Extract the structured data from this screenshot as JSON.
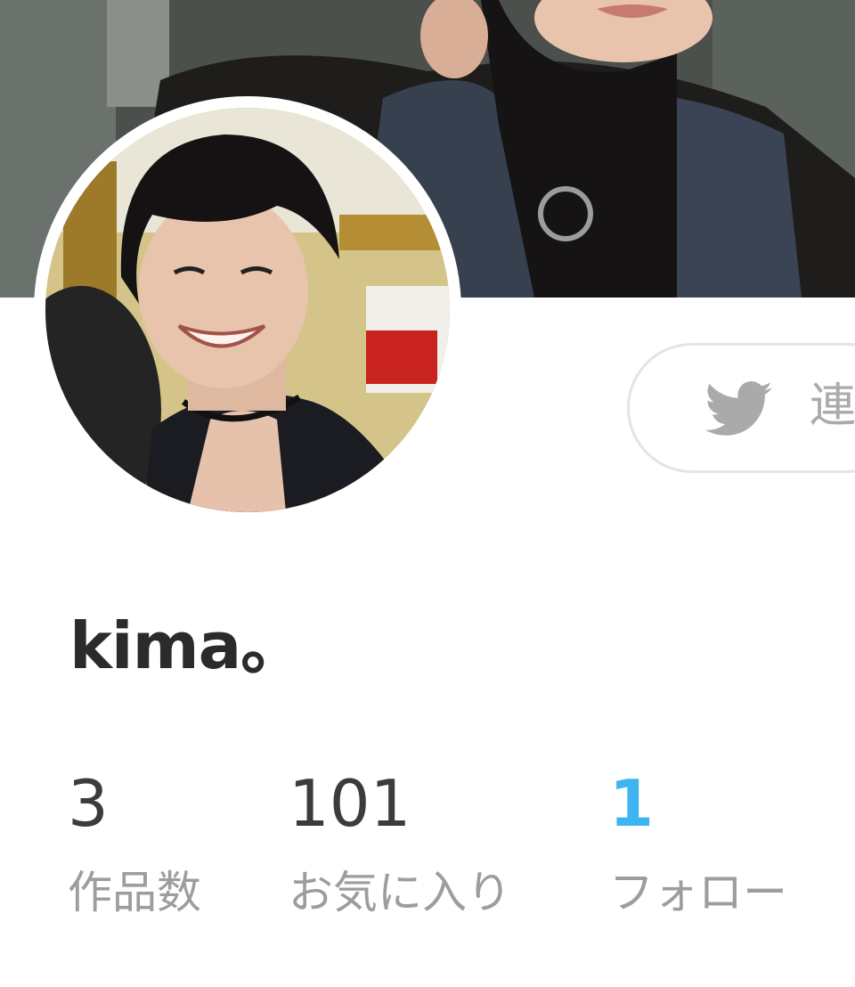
{
  "profile": {
    "username": "kima。",
    "cover_image": "cover-photo",
    "avatar_image": "avatar-photo"
  },
  "link_button": {
    "label": "連",
    "icon": "twitter-icon"
  },
  "stats": [
    {
      "value": "3",
      "label": "作品数"
    },
    {
      "value": "101",
      "label": "お気に入り"
    },
    {
      "value": "1",
      "label": "フォロー"
    }
  ],
  "colors": {
    "accent": "#3eb5f1",
    "text_primary": "#2b2b2b",
    "text_secondary": "#9d9d9d",
    "border": "#e4e4e4",
    "icon": "#aaaaaa"
  }
}
